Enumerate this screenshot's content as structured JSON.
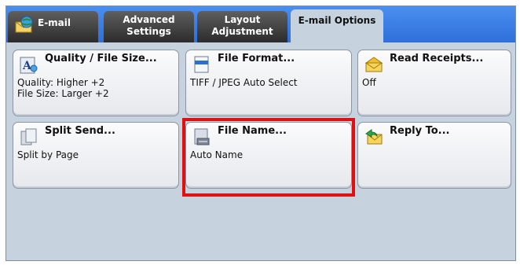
{
  "tabs": [
    {
      "label": "E-mail",
      "icon": "email-globe-icon"
    },
    {
      "label_lines": [
        "Advanced",
        "Settings"
      ]
    },
    {
      "label_lines": [
        "Layout",
        "Adjustment"
      ]
    },
    {
      "label": "E-mail Options",
      "active": true
    }
  ],
  "buttons": {
    "quality": {
      "title": "Quality / File Size...",
      "values": [
        "Quality: Higher +2",
        "File Size: Larger +2"
      ],
      "icon": "quality-icon"
    },
    "file_format": {
      "title": "File Format...",
      "values": [
        "TIFF / JPEG Auto Select"
      ],
      "icon": "file-format-icon"
    },
    "read_receipts": {
      "title": "Read Receipts...",
      "values": [
        "Off"
      ],
      "icon": "read-receipt-envelope-icon"
    },
    "split_send": {
      "title": "Split Send...",
      "values": [
        "Split by Page"
      ],
      "icon": "split-send-icon"
    },
    "file_name": {
      "title": "File Name...",
      "values": [
        "Auto Name"
      ],
      "icon": "file-name-icon",
      "highlighted": true
    },
    "reply_to": {
      "title": "Reply To...",
      "values": [
        ""
      ],
      "icon": "reply-envelope-icon"
    }
  },
  "colors": {
    "tab_bar": "#2f6fd9",
    "tab_inactive": "#3a3a3a",
    "panel_bg": "#c7d2df",
    "highlight_border": "#e01010"
  }
}
